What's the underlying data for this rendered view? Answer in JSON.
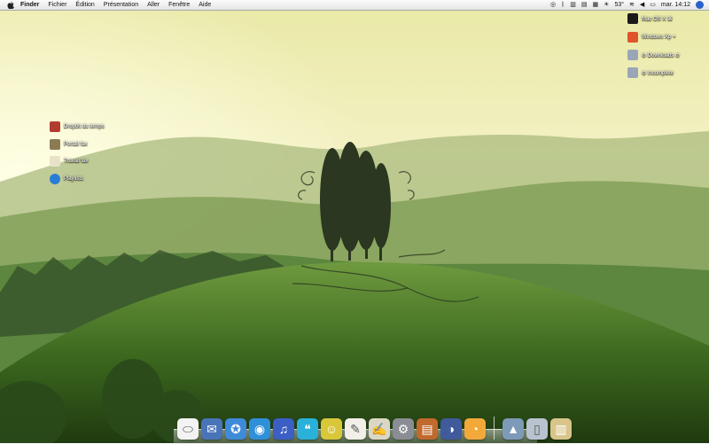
{
  "menubar": {
    "app_name": "Finder",
    "menus": [
      "Fichier",
      "Édition",
      "Présentation",
      "Aller",
      "Fenêtre",
      "Aide"
    ],
    "temperature": "53°",
    "clock": "mar. 14:12"
  },
  "desktop_left": [
    {
      "label": "Dropbit du temps",
      "icon": "red-book-icon",
      "color": "#b23a2f"
    },
    {
      "label": "Portail fax",
      "icon": "pictures-folder-icon",
      "color": "#8a7b52"
    },
    {
      "label": "Travail fax",
      "icon": "notepad-icon",
      "color": "#e9e2c8"
    },
    {
      "label": "Playlists",
      "icon": "music-note-icon",
      "color": "#2a7dd6"
    }
  ],
  "desktop_right": [
    {
      "label": "Mac OS X ⌘",
      "icon": "macosx-x-icon",
      "color": "#1a1a1a"
    },
    {
      "label": "Windows Xp +",
      "icon": "windows-logo-icon",
      "color": "#e0542b"
    },
    {
      "label": "⊘ Downloads ⊘",
      "icon": "downloads-drive-icon",
      "color": "#9aa6b8"
    },
    {
      "label": "⊘ Incomplete",
      "icon": "incomplete-drive-icon",
      "color": "#9aa6b8"
    }
  ],
  "dock": {
    "apps": [
      {
        "name": "finder-mouse",
        "glyph": "⬭",
        "color": "#f3f3f3"
      },
      {
        "name": "mail",
        "glyph": "✉",
        "color": "#4a74b8"
      },
      {
        "name": "safari",
        "glyph": "✪",
        "color": "#3f8ad9"
      },
      {
        "name": "network-globe",
        "glyph": "◉",
        "color": "#2f8fd8"
      },
      {
        "name": "itunes",
        "glyph": "♫",
        "color": "#3b5fc4"
      },
      {
        "name": "ichat",
        "glyph": "❝",
        "color": "#2ab1d9"
      },
      {
        "name": "adium-duck",
        "glyph": "☺",
        "color": "#d9c73a"
      },
      {
        "name": "notes",
        "glyph": "✎",
        "color": "#f1efe7"
      },
      {
        "name": "script-editor",
        "glyph": "✍",
        "color": "#dcd7c5"
      },
      {
        "name": "system-preferences",
        "glyph": "⚙",
        "color": "#8a8d93"
      },
      {
        "name": "calendar-book",
        "glyph": "▤",
        "color": "#c06a2e"
      },
      {
        "name": "quicktime",
        "glyph": "◑",
        "color": "#405b9c"
      },
      {
        "name": "rss-reader",
        "glyph": "◔",
        "color": "#f2a93a"
      }
    ],
    "stacks": [
      {
        "name": "applications-stack",
        "glyph": "▲",
        "color": "#7d9ab8"
      },
      {
        "name": "documents-stack",
        "glyph": "▯",
        "color": "#b9c3cf"
      },
      {
        "name": "trash",
        "glyph": "▥",
        "color": "#d9c58a"
      }
    ]
  }
}
